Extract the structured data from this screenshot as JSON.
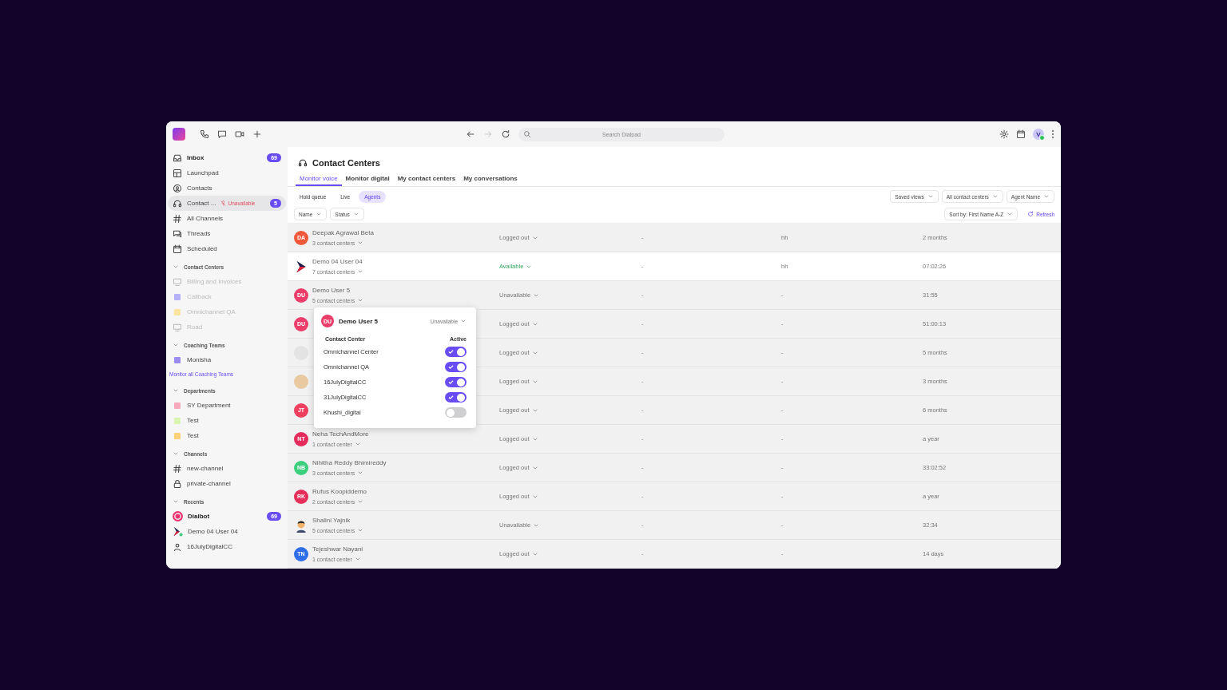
{
  "toolbar": {
    "quick_actions": [
      {
        "kind": "phone"
      },
      {
        "kind": "chat"
      },
      {
        "kind": "video"
      },
      {
        "kind": "plus"
      }
    ],
    "nav_buttons": [
      {
        "kind": "back",
        "disabled": false
      },
      {
        "kind": "forward",
        "disabled": true
      },
      {
        "kind": "reload",
        "disabled": false
      }
    ],
    "search": {
      "placeholder": "Search Dialpad"
    },
    "user": {
      "initial": "V",
      "online": true
    }
  },
  "sidebar": {
    "nav": [
      {
        "kind": "inbox",
        "label": "Inbox",
        "unread": true,
        "badge": "69",
        "selected": false
      },
      {
        "kind": "launchpad",
        "label": "Launchpad",
        "unread": false,
        "selected": false
      },
      {
        "kind": "contacts",
        "label": "Contacts",
        "unread": false,
        "selected": false
      },
      {
        "kind": "headset",
        "label": "Contact ...",
        "status": "Unavailable",
        "unread": false,
        "badge": "5",
        "selected": true
      },
      {
        "kind": "hash",
        "label": "All Channels",
        "unread": false,
        "selected": false
      },
      {
        "kind": "threads",
        "label": "Threads",
        "unread": false,
        "selected": false
      },
      {
        "kind": "calendar",
        "label": "Scheduled",
        "unread": false,
        "selected": false
      }
    ],
    "sections": [
      {
        "title": "Contact Centers",
        "expanded": true,
        "items": [
          {
            "kind": "monitor",
            "label": "Billing and Invoices",
            "disabled": true
          },
          {
            "kind": "square",
            "label": "Callback",
            "color": "#b5b0f7",
            "disabled": true
          },
          {
            "kind": "square",
            "label": "Omnichannel QA",
            "color": "#fbe3a0",
            "disabled": true
          },
          {
            "kind": "monitor",
            "label": "Road",
            "disabled": true
          }
        ]
      },
      {
        "title": "Coaching Teams",
        "expanded": true,
        "items": [
          {
            "kind": "square",
            "label": "Monisha",
            "color": "#9b8cf2",
            "disabled": false
          }
        ],
        "link": "Monitor all Coaching Teams"
      },
      {
        "title": "Departments",
        "expanded": true,
        "items": [
          {
            "kind": "square",
            "label": "SY Department",
            "color": "#f6a9bd",
            "disabled": false
          },
          {
            "kind": "square",
            "label": "Test",
            "color": "#dcf5b0",
            "disabled": false
          },
          {
            "kind": "square",
            "label": "Test",
            "color": "#fbd27a",
            "disabled": false
          }
        ]
      },
      {
        "title": "Channels",
        "expanded": true,
        "items": [
          {
            "kind": "hash",
            "label": "new-channel",
            "disabled": false
          },
          {
            "kind": "lock",
            "label": "private-channel",
            "disabled": false
          }
        ]
      },
      {
        "title": "Recents",
        "expanded": true,
        "items": [
          {
            "kind": "bot",
            "label": "Dialbot",
            "unread": true,
            "badge": "69",
            "disabled": false
          },
          {
            "kind": "logo",
            "label": "Demo 04 User 04",
            "disabled": false
          },
          {
            "kind": "person",
            "label": "16JulyDigitalCC",
            "disabled": false
          }
        ]
      }
    ]
  },
  "main": {
    "title": "Contact Centers",
    "tabs": [
      {
        "label": "Monitor voice",
        "selected": true
      },
      {
        "label": "Monitor digital",
        "selected": false
      },
      {
        "label": "My contact centers",
        "selected": false
      },
      {
        "label": "My conversations",
        "selected": false
      }
    ],
    "subtabs": [
      {
        "label": "Hold queue",
        "selected": false
      },
      {
        "label": "Live",
        "selected": false
      },
      {
        "label": "Agents",
        "selected": true
      }
    ],
    "view_filters": [
      "Saved views",
      "All contact centers",
      "Agent Name"
    ],
    "column_filters": [
      "Name",
      "Status"
    ],
    "sort": "Sort by: First Name A-Z",
    "refresh": "Refresh",
    "rows": [
      {
        "avatar": {
          "kind": "initials",
          "text": "DA",
          "color": "#f2593a"
        },
        "name": "Deepak Agrawal Beta",
        "centers": "3 contact centers",
        "status": "Logged out",
        "available": false,
        "column_3": "-",
        "column_4": "hh",
        "column_5": "2 months",
        "selected": false
      },
      {
        "avatar": {
          "kind": "logo"
        },
        "name": "Demo 04 User 04",
        "centers": "7 contact centers",
        "status": "Available",
        "available": true,
        "column_3": "-",
        "column_4": "hh",
        "column_5": "07:02:26",
        "selected": true
      },
      {
        "avatar": {
          "kind": "initials",
          "text": "DU",
          "color": "#ea3d6a"
        },
        "name": "Demo User 5",
        "centers": "5 contact centers",
        "status": "Unavailable",
        "available": false,
        "column_3": "-",
        "column_4": "-",
        "column_5": "31:55",
        "selected": false
      },
      {
        "avatar": {
          "kind": "initials",
          "text": "DU",
          "color": "#ea3d6a"
        },
        "status": "Logged out",
        "available": false,
        "column_3": "-",
        "column_4": "-",
        "column_5": "51:00:13",
        "selected": false
      },
      {
        "avatar": {
          "kind": "blank"
        },
        "status": "Logged out",
        "available": false,
        "column_3": "-",
        "column_4": "-",
        "column_5": "5 months",
        "selected": false
      },
      {
        "avatar": {
          "kind": "photo"
        },
        "status": "Logged out",
        "available": false,
        "column_3": "-",
        "column_4": "-",
        "column_5": "3 months",
        "selected": false
      },
      {
        "avatar": {
          "kind": "initials",
          "text": "JT",
          "color": "#ef3f5f"
        },
        "status": "Logged out",
        "available": false,
        "column_3": "-",
        "column_4": "-",
        "column_5": "6 months",
        "selected": false
      },
      {
        "avatar": {
          "kind": "initials",
          "text": "NT",
          "color": "#e52a5c"
        },
        "name": "Neha TechAndMore",
        "centers": "1 contact center",
        "status": "Logged out",
        "available": false,
        "column_3": "-",
        "column_4": "-",
        "column_5": "a year",
        "selected": false
      },
      {
        "avatar": {
          "kind": "initials",
          "text": "NB",
          "color": "#3ccf7e"
        },
        "name": "Nihitha Reddy Bhimireddy",
        "centers": "3 contact centers",
        "status": "Logged out",
        "available": false,
        "column_3": "-",
        "column_4": "-",
        "column_5": "33:02:52",
        "selected": false
      },
      {
        "avatar": {
          "kind": "initials",
          "text": "RK",
          "color": "#e62e5a"
        },
        "name": "Rufus Koopiddemo",
        "centers": "2 contact centers",
        "status": "Logged out",
        "available": false,
        "column_3": "-",
        "column_4": "-",
        "column_5": "a year",
        "selected": false
      },
      {
        "avatar": {
          "kind": "illustration"
        },
        "name": "Shalini Yajnik",
        "centers": "5 contact centers",
        "status": "Unavailable",
        "available": false,
        "column_3": "-",
        "column_4": "-",
        "column_5": "32:34",
        "selected": false
      },
      {
        "avatar": {
          "kind": "initials",
          "text": "TN",
          "color": "#2f6ee8"
        },
        "name": "Tejeshwar Nayani",
        "centers": "1 contact center",
        "status": "Logged out",
        "available": false,
        "column_3": "-",
        "column_4": "-",
        "column_5": "14 days",
        "selected": false
      }
    ],
    "popup": {
      "avatar": {
        "kind": "initials",
        "text": "DU",
        "color": "#ea3d6a"
      },
      "name": "Demo User 5",
      "status": "Unavailable",
      "header_center": "Contact Center",
      "header_active": "Active",
      "centers": [
        {
          "name": "Omnichannel Center",
          "on": true
        },
        {
          "name": "Omnichannel QA",
          "on": true
        },
        {
          "name": "16JulyDigitalCC",
          "on": true
        },
        {
          "name": "31JulyDigitalCC",
          "on": true
        },
        {
          "name": "Khushi_digital",
          "on": false
        }
      ]
    }
  }
}
